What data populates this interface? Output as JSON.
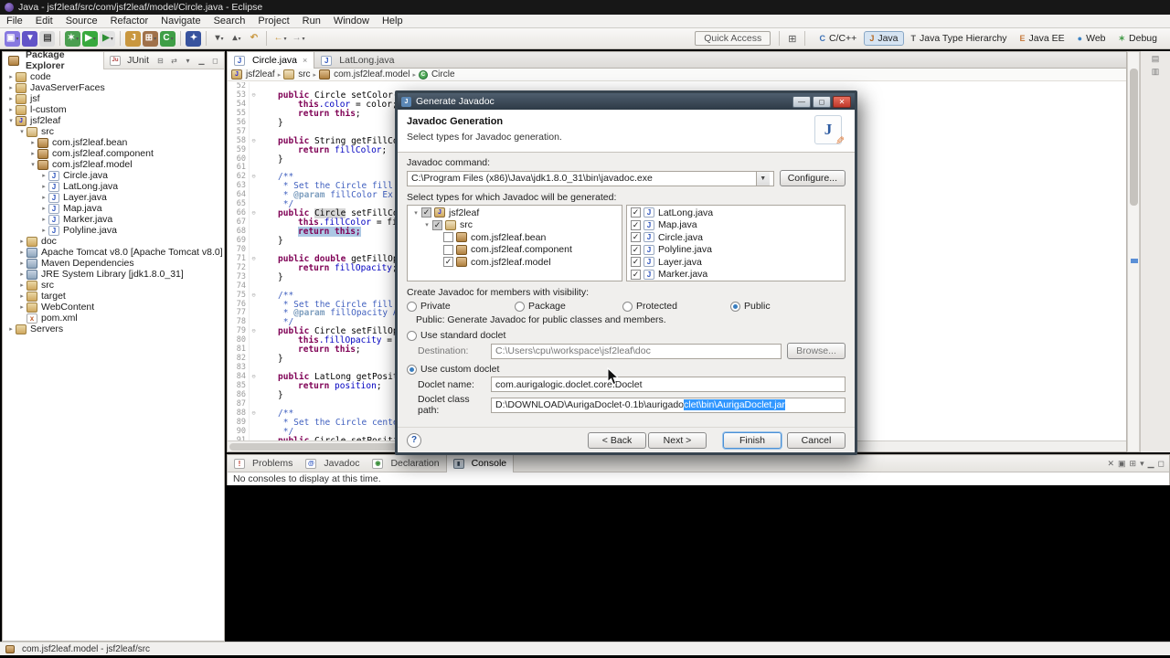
{
  "titlebar": {
    "title": "Java - jsf2leaf/src/com/jsf2leaf/model/Circle.java - Eclipse"
  },
  "menubar": {
    "items": [
      "File",
      "Edit",
      "Source",
      "Refactor",
      "Navigate",
      "Search",
      "Project",
      "Run",
      "Window",
      "Help"
    ]
  },
  "toolbar": {
    "quick_access": "Quick Access",
    "groups": [
      [
        {
          "n": "new-wizard",
          "g": "▣",
          "fg": "#fff",
          "bg": "#8678e0",
          "dd": 1
        },
        {
          "n": "save",
          "g": "▼",
          "fg": "#fff",
          "bg": "#6254c7"
        },
        {
          "n": "print",
          "g": "▤",
          "fg": "#444",
          "bg": "#dcdcdc"
        }
      ],
      [
        {
          "n": "debug",
          "g": "✶",
          "fg": "#fff",
          "bg": "#4a9e4f",
          "dd": 1
        },
        {
          "n": "run",
          "g": "▶",
          "fg": "#fff",
          "bg": "#38a93d",
          "dd": 1
        },
        {
          "n": "external-tools",
          "g": "▶",
          "fg": "#2f8f35",
          "bg": "#e2e2e2",
          "dd": 1
        }
      ],
      [
        {
          "n": "new-java-project",
          "g": "J",
          "fg": "#fff",
          "bg": "#c9973f"
        },
        {
          "n": "new-package",
          "g": "⊞",
          "fg": "#fff",
          "bg": "#a0714a",
          "dd": 1
        },
        {
          "n": "new-class",
          "g": "C",
          "fg": "#fff",
          "bg": "#3f9e46",
          "dd": 1
        }
      ],
      [
        {
          "n": "search",
          "g": "✦",
          "fg": "#fff",
          "bg": "#38539e"
        }
      ],
      [
        {
          "n": "next-annotation",
          "g": "▾",
          "fg": "#555",
          "dd": 1
        },
        {
          "n": "previous-annotation",
          "g": "▴",
          "fg": "#555",
          "dd": 1
        },
        {
          "n": "last-edit-location",
          "g": "↶",
          "fg": "#c9973f"
        }
      ],
      [
        {
          "n": "back",
          "g": "←",
          "fg": "#c9973f",
          "dd": 1
        },
        {
          "n": "forward",
          "g": "→",
          "fg": "#9a9a9a",
          "dd": 1
        }
      ]
    ],
    "perspectives": {
      "open_glyph": "⊞",
      "items": [
        {
          "label": "C/C++",
          "g": "C",
          "c": "#3b6fb5"
        },
        {
          "label": "Java",
          "g": "J",
          "c": "#b5651d",
          "active": true
        },
        {
          "label": "Java Type Hierarchy",
          "g": "T",
          "c": "#555555"
        },
        {
          "label": "Java EE",
          "g": "E",
          "c": "#c77b3f"
        },
        {
          "label": "Web",
          "g": "●",
          "c": "#3b82c4"
        },
        {
          "label": "Debug",
          "g": "✶",
          "c": "#4a9e4f"
        }
      ]
    }
  },
  "package_explorer": {
    "tabs": [
      {
        "label": "Package Explorer",
        "icon": "package-explorer",
        "active": true
      },
      {
        "label": "JUnit",
        "icon": "junit",
        "active": false
      }
    ],
    "header_icons": [
      {
        "n": "collapse-all",
        "g": "⊟"
      },
      {
        "n": "link-with-editor",
        "g": "⇄"
      },
      {
        "n": "view-menu",
        "g": "▾"
      },
      {
        "n": "minimize",
        "g": "▁"
      },
      {
        "n": "maximize",
        "g": "◻"
      }
    ],
    "tree": [
      {
        "label": "code",
        "i": 0,
        "icon": "folder",
        "x": "c"
      },
      {
        "label": "JavaServerFaces",
        "i": 0,
        "icon": "folder",
        "x": "c"
      },
      {
        "label": "jsf",
        "i": 0,
        "icon": "folder",
        "x": "c"
      },
      {
        "label": "l-custom",
        "i": 0,
        "icon": "folder",
        "x": "c"
      },
      {
        "label": "jsf2leaf",
        "i": 0,
        "icon": "project",
        "x": "e"
      },
      {
        "label": "src",
        "i": 1,
        "icon": "srcfolder",
        "x": "e"
      },
      {
        "label": "com.jsf2leaf.bean",
        "i": 2,
        "icon": "package",
        "x": "c"
      },
      {
        "label": "com.jsf2leaf.component",
        "i": 2,
        "icon": "package",
        "x": "c"
      },
      {
        "label": "com.jsf2leaf.model",
        "i": 2,
        "icon": "package",
        "x": "e"
      },
      {
        "label": "Circle.java",
        "i": 3,
        "icon": "jfile",
        "x": "c"
      },
      {
        "label": "LatLong.java",
        "i": 3,
        "icon": "jfile",
        "x": "c"
      },
      {
        "label": "Layer.java",
        "i": 3,
        "icon": "jfile",
        "x": "c"
      },
      {
        "label": "Map.java",
        "i": 3,
        "icon": "jfile",
        "x": "c"
      },
      {
        "label": "Marker.java",
        "i": 3,
        "icon": "jfile",
        "x": "c"
      },
      {
        "label": "Polyline.java",
        "i": 3,
        "icon": "jfile",
        "x": "c"
      },
      {
        "label": "doc",
        "i": 1,
        "icon": "folder",
        "x": "c"
      },
      {
        "label": "Apache Tomcat v8.0 [Apache Tomcat v8.0]",
        "i": 1,
        "icon": "library",
        "x": "c"
      },
      {
        "label": "Maven Dependencies",
        "i": 1,
        "icon": "library",
        "x": "c"
      },
      {
        "label": "JRE System Library [jdk1.8.0_31]",
        "i": 1,
        "icon": "library",
        "x": "c"
      },
      {
        "label": "src",
        "i": 1,
        "icon": "folder",
        "x": "c"
      },
      {
        "label": "target",
        "i": 1,
        "icon": "folder",
        "x": "c"
      },
      {
        "label": "WebContent",
        "i": 1,
        "icon": "folder",
        "x": "c"
      },
      {
        "label": "pom.xml",
        "i": 1,
        "icon": "xmlfile",
        "x": ""
      },
      {
        "label": "Servers",
        "i": 0,
        "icon": "folder",
        "x": "c"
      }
    ]
  },
  "editor": {
    "tabs": [
      {
        "label": "Circle.java",
        "active": true
      },
      {
        "label": "LatLong.java",
        "active": false
      }
    ],
    "breadcrumb": [
      {
        "label": "jsf2leaf",
        "icon": "project"
      },
      {
        "label": "src",
        "icon": "srcfolder"
      },
      {
        "label": "com.jsf2leaf.model",
        "icon": "package"
      },
      {
        "label": "Circle",
        "icon": "class"
      }
    ],
    "lines": [
      {
        "n": 52,
        "i": 1,
        "t": []
      },
      {
        "n": 53,
        "i": 1,
        "fd": 1,
        "t": [
          [
            "k",
            "public "
          ],
          [
            "p",
            "Circle setColor(String"
          ]
        ]
      },
      {
        "n": 54,
        "i": 2,
        "t": [
          [
            "k",
            "this"
          ],
          [
            "f",
            ".color"
          ],
          [
            "p",
            " = color;"
          ]
        ]
      },
      {
        "n": 55,
        "i": 2,
        "t": [
          [
            "k",
            "return this"
          ],
          [
            "p",
            ";"
          ]
        ]
      },
      {
        "n": 56,
        "i": 1,
        "t": [
          [
            "p",
            "}"
          ]
        ]
      },
      {
        "n": 57,
        "i": 1,
        "t": []
      },
      {
        "n": 58,
        "i": 1,
        "fd": 1,
        "t": [
          [
            "k",
            "public "
          ],
          [
            "p",
            "String getFillColor()"
          ]
        ]
      },
      {
        "n": 59,
        "i": 2,
        "t": [
          [
            "k",
            "return "
          ],
          [
            "f",
            "fillColor"
          ],
          [
            "p",
            ";"
          ]
        ]
      },
      {
        "n": 60,
        "i": 1,
        "t": [
          [
            "p",
            "}"
          ]
        ]
      },
      {
        "n": 61,
        "i": 1,
        "t": []
      },
      {
        "n": 62,
        "i": 1,
        "fd": 1,
        "t": [
          [
            "c",
            "/**"
          ]
        ]
      },
      {
        "n": 63,
        "i": 1,
        "t": [
          [
            "c",
            " * Set the Circle fill color"
          ]
        ]
      },
      {
        "n": 64,
        "i": 1,
        "t": [
          [
            "c",
            " * "
          ],
          [
            "ck",
            "@param"
          ],
          [
            "c",
            " fillColor Ex: \"blu"
          ]
        ]
      },
      {
        "n": 65,
        "i": 1,
        "t": [
          [
            "c",
            " */"
          ]
        ]
      },
      {
        "n": 66,
        "i": 1,
        "fd": 1,
        "t": [
          [
            "k",
            "public "
          ],
          [
            "p",
            "Circle",
            "occ"
          ],
          [
            "p",
            " setFillColor(St"
          ]
        ]
      },
      {
        "n": 67,
        "i": 2,
        "t": [
          [
            "k",
            "this"
          ],
          [
            "f",
            ".fillColor"
          ],
          [
            "p",
            " = fillColo"
          ]
        ]
      },
      {
        "n": 68,
        "i": 2,
        "t": [
          [
            "k",
            "return this;",
            "sel"
          ]
        ]
      },
      {
        "n": 69,
        "i": 1,
        "t": [
          [
            "p",
            "}"
          ]
        ]
      },
      {
        "n": 70,
        "i": 1,
        "t": []
      },
      {
        "n": 71,
        "i": 1,
        "fd": 1,
        "t": [
          [
            "k",
            "public double "
          ],
          [
            "p",
            "getFillOpacity"
          ]
        ]
      },
      {
        "n": 72,
        "i": 2,
        "t": [
          [
            "k",
            "return "
          ],
          [
            "f",
            "fillOpacity"
          ],
          [
            "p",
            ";"
          ]
        ]
      },
      {
        "n": 73,
        "i": 1,
        "t": [
          [
            "p",
            "}"
          ]
        ]
      },
      {
        "n": 74,
        "i": 1,
        "t": []
      },
      {
        "n": 75,
        "i": 1,
        "fd": 1,
        "t": [
          [
            "c",
            "/**"
          ]
        ]
      },
      {
        "n": 76,
        "i": 1,
        "t": [
          [
            "c",
            " * Set the Circle fill color"
          ]
        ]
      },
      {
        "n": 77,
        "i": 1,
        "t": [
          [
            "c",
            " * "
          ],
          [
            "ck",
            "@param"
          ],
          [
            "c",
            " fillOpacity Accept"
          ]
        ]
      },
      {
        "n": 78,
        "i": 1,
        "t": [
          [
            "c",
            " */"
          ]
        ]
      },
      {
        "n": 79,
        "i": 1,
        "fd": 1,
        "t": [
          [
            "k",
            "public "
          ],
          [
            "p",
            "Circle setFillOpacity"
          ]
        ]
      },
      {
        "n": 80,
        "i": 2,
        "t": [
          [
            "k",
            "this"
          ],
          [
            "f",
            ".fillOpacity"
          ],
          [
            "p",
            " = fillO"
          ]
        ]
      },
      {
        "n": 81,
        "i": 2,
        "t": [
          [
            "k",
            "return this"
          ],
          [
            "p",
            ";"
          ]
        ]
      },
      {
        "n": 82,
        "i": 1,
        "t": [
          [
            "p",
            "}"
          ]
        ]
      },
      {
        "n": 83,
        "i": 1,
        "t": []
      },
      {
        "n": 84,
        "i": 1,
        "fd": 1,
        "t": [
          [
            "k",
            "public "
          ],
          [
            "p",
            "LatLong getPosition()"
          ]
        ]
      },
      {
        "n": 85,
        "i": 2,
        "t": [
          [
            "k",
            "return "
          ],
          [
            "f",
            "position"
          ],
          [
            "p",
            ";"
          ]
        ]
      },
      {
        "n": 86,
        "i": 1,
        "t": [
          [
            "p",
            "}"
          ]
        ]
      },
      {
        "n": 87,
        "i": 1,
        "t": []
      },
      {
        "n": 88,
        "i": 1,
        "fd": 1,
        "t": [
          [
            "c",
            "/**"
          ]
        ]
      },
      {
        "n": 89,
        "i": 1,
        "t": [
          [
            "c",
            " * Set the Circle center pos"
          ]
        ]
      },
      {
        "n": 90,
        "i": 1,
        "t": [
          [
            "c",
            " */"
          ]
        ]
      },
      {
        "n": 91,
        "i": 1,
        "t": [
          [
            "k",
            "public "
          ],
          [
            "p",
            "Circle setPosition(LatLong position) {"
          ]
        ]
      }
    ]
  },
  "dialog": {
    "title": "Generate Javadoc",
    "header_title": "Javadoc Generation",
    "header_desc": "Select types for Javadoc generation.",
    "command_label": "Javadoc command:",
    "command_value": "C:\\Program Files (x86)\\Java\\jdk1.8.0_31\\bin\\javadoc.exe",
    "configure_button": "Configure...",
    "types_label": "Select types for which Javadoc will be generated:",
    "tree": [
      {
        "label": "jsf2leaf",
        "i": 0,
        "icon": "project",
        "x": "e",
        "cb": "gray"
      },
      {
        "label": "src",
        "i": 1,
        "icon": "srcfolder",
        "x": "e",
        "cb": "gray"
      },
      {
        "label": "com.jsf2leaf.bean",
        "i": 2,
        "icon": "package",
        "x": "",
        "cb": "off"
      },
      {
        "label": "com.jsf2leaf.component",
        "i": 2,
        "icon": "package",
        "x": "",
        "cb": "off"
      },
      {
        "label": "com.jsf2leaf.model",
        "i": 2,
        "icon": "package",
        "x": "",
        "cb": "on"
      }
    ],
    "files": [
      {
        "label": "LatLong.java",
        "cb": "on"
      },
      {
        "label": "Map.java",
        "cb": "on"
      },
      {
        "label": "Circle.java",
        "cb": "on"
      },
      {
        "label": "Polyline.java",
        "cb": "on"
      },
      {
        "label": "Layer.java",
        "cb": "on"
      },
      {
        "label": "Marker.java",
        "cb": "on"
      }
    ],
    "visibility_label": "Create Javadoc for members with visibility:",
    "visibility_options": [
      {
        "label": "Private",
        "selected": false
      },
      {
        "label": "Package",
        "selected": false
      },
      {
        "label": "Protected",
        "selected": false
      },
      {
        "label": "Public",
        "selected": true
      }
    ],
    "visibility_note": "Public: Generate Javadoc for public classes and members.",
    "standard_doclet_label": "Use standard doclet",
    "destination_label": "Destination:",
    "destination_value": "C:\\Users\\cpu\\workspace\\jsf2leaf\\doc",
    "browse_button": "Browse...",
    "custom_doclet_label": "Use custom doclet",
    "doclet_name_label": "Doclet name:",
    "doclet_name_value": "com.aurigalogic.doclet.core.Doclet",
    "doclet_path_label": "Doclet class path:",
    "doclet_path_pre": "D:\\DOWNLOAD\\AurigaDoclet-0.1b\\aurigado",
    "doclet_path_sel": "clet\\bin\\AurigaDoclet.jar",
    "help_glyph": "?",
    "buttons": {
      "back": "< Back",
      "next": "Next >",
      "finish": "Finish",
      "cancel": "Cancel"
    }
  },
  "console": {
    "tabs": [
      {
        "label": "Problems",
        "icon": "problems",
        "active": false
      },
      {
        "label": "Javadoc",
        "icon": "javadoc",
        "active": false
      },
      {
        "label": "Declaration",
        "icon": "declaration",
        "active": false
      },
      {
        "label": "Console",
        "icon": "console",
        "active": true
      }
    ],
    "icons": [
      {
        "n": "clear-console",
        "g": "✕"
      },
      {
        "n": "display-selected-console",
        "g": "▣"
      },
      {
        "n": "open-console",
        "g": "⊞"
      },
      {
        "n": "view-menu",
        "g": "▾"
      },
      {
        "n": "minimize",
        "g": "▁"
      },
      {
        "n": "maximize",
        "g": "◻"
      }
    ],
    "message": "No consoles to display at this time."
  },
  "trim_icons": [
    {
      "n": "minimized-view-1",
      "g": "▤"
    },
    {
      "n": "minimized-view-2",
      "g": "▥"
    }
  ],
  "statusbar": {
    "text": "com.jsf2leaf.model - jsf2leaf/src"
  }
}
